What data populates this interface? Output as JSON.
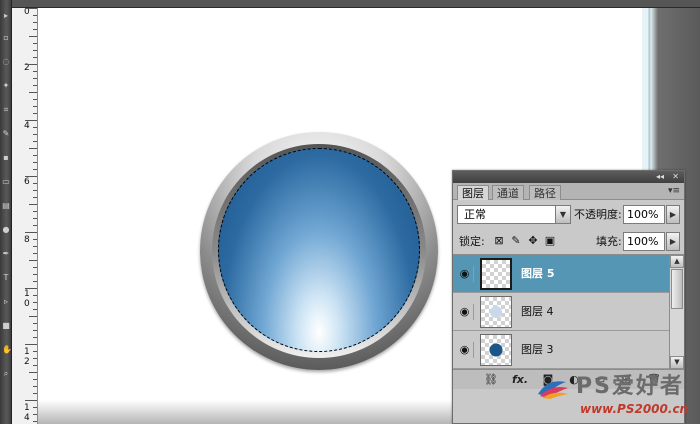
{
  "ruler": {
    "marks": [
      "0",
      "2",
      "4",
      "6",
      "8",
      "1",
      "0",
      "1",
      "2",
      "1",
      "4"
    ]
  },
  "layers_panel": {
    "tabs": [
      "图层",
      "通道",
      "路径"
    ],
    "active_tab": "图层",
    "blend_mode": "正常",
    "opacity_label": "不透明度:",
    "opacity_value": "100%",
    "lock_label": "锁定:",
    "fill_label": "填充:",
    "fill_value": "100%",
    "layers": [
      {
        "name": "图层 5",
        "selected": true,
        "thumb": "empty"
      },
      {
        "name": "图层 4",
        "selected": false,
        "thumb": "light-blue-dot"
      },
      {
        "name": "图层 3",
        "selected": false,
        "thumb": "dark-blue-dot"
      }
    ],
    "bottom_icons": [
      "link-icon",
      "fx-icon",
      "mask-icon",
      "adjustment-icon",
      "group-icon",
      "new-layer-icon",
      "trash-icon"
    ],
    "fx_label": "fx."
  },
  "colors": {
    "selected_layer": "#5596b4",
    "button_blue": "#1c5589"
  },
  "watermark": {
    "cn_text": "PS爱好者",
    "url": "www.PS2000.cn"
  }
}
